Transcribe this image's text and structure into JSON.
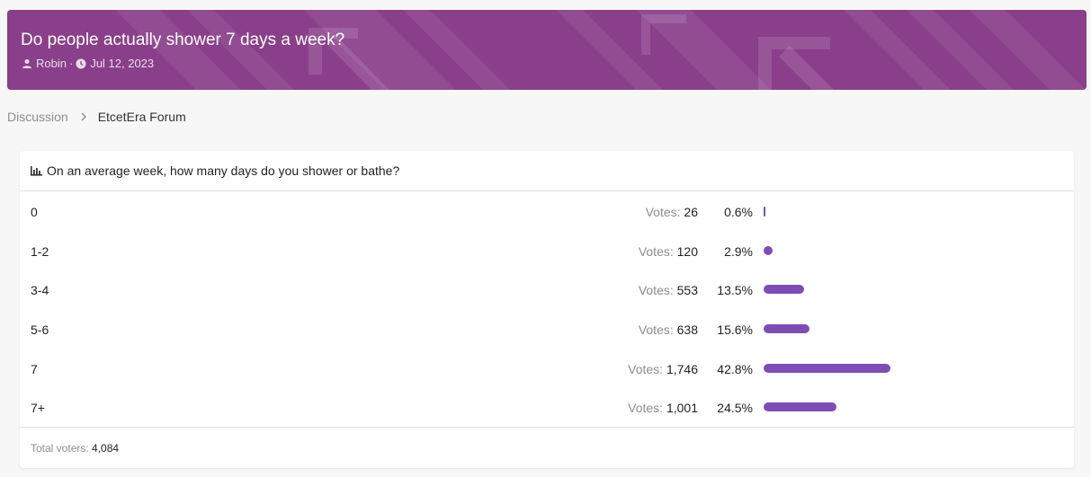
{
  "thread": {
    "title": "Do people actually shower 7 days a week?",
    "author": "Robin",
    "meta_separator": "·",
    "date": "Jul 12, 2023",
    "accent_color": "#8a3f8a"
  },
  "breadcrumb": {
    "items": [
      "Discussion",
      "EtcetEra Forum"
    ]
  },
  "poll": {
    "question": "On an average week, how many days do you shower or bathe?",
    "votes_label": "Votes:",
    "bar_color": "#7e4db3",
    "options": [
      {
        "label": "0",
        "votes": "26",
        "percent": "0.6%",
        "fraction": 0.006
      },
      {
        "label": "1-2",
        "votes": "120",
        "percent": "2.9%",
        "fraction": 0.029
      },
      {
        "label": "3-4",
        "votes": "553",
        "percent": "13.5%",
        "fraction": 0.135
      },
      {
        "label": "5-6",
        "votes": "638",
        "percent": "15.6%",
        "fraction": 0.156
      },
      {
        "label": "7",
        "votes": "1,746",
        "percent": "42.8%",
        "fraction": 0.428
      },
      {
        "label": "7+",
        "votes": "1,001",
        "percent": "24.5%",
        "fraction": 0.245
      }
    ],
    "total_label": "Total voters:",
    "total_value": "4,084"
  },
  "icons": {
    "author": "user-icon",
    "date": "clock-icon",
    "breadcrumb_separator": "chevron-right-icon",
    "poll": "bar-chart-icon"
  }
}
